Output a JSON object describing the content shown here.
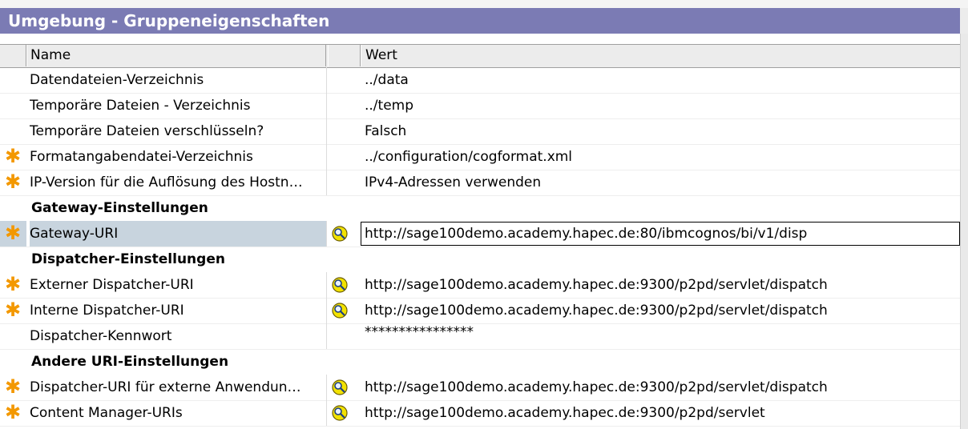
{
  "title": "Umgebung - Gruppeneigenschaften",
  "columns": {
    "name": "Name",
    "value": "Wert"
  },
  "rows": [
    {
      "name": "Datendateien-Verzeichnis",
      "value": "../data"
    },
    {
      "name": "Temporäre Dateien - Verzeichnis",
      "value": "../temp"
    },
    {
      "name": "Temporäre Dateien verschlüsseln?",
      "value": "Falsch"
    },
    {
      "name": "Formatangabendatei-Verzeichnis",
      "value": "../configuration/cogformat.xml",
      "required": true
    },
    {
      "name": "IP-Version für die Auflösung des Hostn…",
      "value": "IPv4-Adressen verwenden",
      "required": true
    }
  ],
  "groups": {
    "gateway": {
      "label": "Gateway-Einstellungen",
      "rows": [
        {
          "name": "Gateway-URI",
          "value": "http://sage100demo.academy.hapec.de:80/ibmcognos/bi/v1/disp",
          "required": true,
          "test_icon": "url-test-icon",
          "selected": true
        }
      ]
    },
    "dispatcher": {
      "label": "Dispatcher-Einstellungen",
      "rows": [
        {
          "name": "Externer Dispatcher-URI",
          "value": "http://sage100demo.academy.hapec.de:9300/p2pd/servlet/dispatch",
          "required": true,
          "test_icon": "url-test-icon"
        },
        {
          "name": "Interne Dispatcher-URI",
          "value": "http://sage100demo.academy.hapec.de:9300/p2pd/servlet/dispatch",
          "required": true,
          "test_icon": "url-test-icon"
        },
        {
          "name": "Dispatcher-Kennwort",
          "value": "****************"
        }
      ]
    },
    "other": {
      "label": "Andere URI-Einstellungen",
      "rows": [
        {
          "name": "Dispatcher-URI für externe Anwendun…",
          "value": "http://sage100demo.academy.hapec.de:9300/p2pd/servlet/dispatch",
          "required": true,
          "test_icon": "url-test-icon"
        },
        {
          "name": "Content Manager-URIs",
          "value": "http://sage100demo.academy.hapec.de:9300/p2pd/servlet",
          "required": true,
          "test_icon": "url-test-icon"
        }
      ]
    }
  },
  "required_marker": "✱",
  "colors": {
    "title_bar": "#7b7bb4",
    "required": "#f39800",
    "selection": "#c8d4de"
  }
}
